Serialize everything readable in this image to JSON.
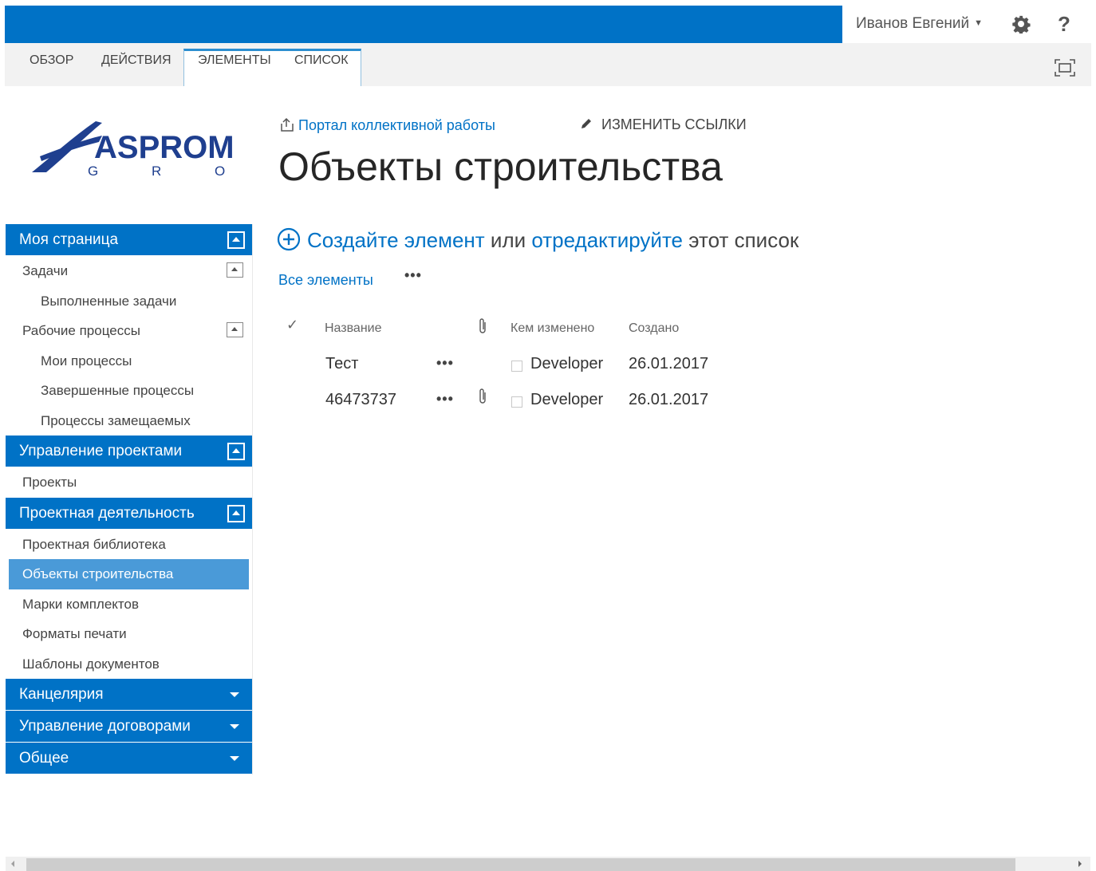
{
  "suitebar": {
    "user_name": "Иванов Евгений",
    "settings_icon": "gear-icon",
    "help_label": "?"
  },
  "ribbon": {
    "tabs": [
      {
        "label": "ОБЗОР"
      },
      {
        "label": "ДЕЙСТВИЯ"
      },
      {
        "label": "ЭЛЕМЕНТЫ"
      },
      {
        "label": "СПИСОК"
      }
    ],
    "focus_icon": "focus-on-content-icon"
  },
  "header": {
    "logo_text": "ASPROM",
    "logo_subtext": "G R O U P",
    "portal_link": "Портал коллективной работы",
    "edit_links": "ИЗМЕНИТЬ ССЫЛКИ",
    "title": "Объекты строительства"
  },
  "nav": {
    "groups": [
      {
        "title": "Моя страница",
        "items": [
          "Задачи",
          "Выполненные задачи",
          "Рабочие процессы",
          "Мои процессы",
          "Завершенные процессы",
          "Процессы замещаемых"
        ]
      },
      {
        "title": "Управление проектами",
        "items": [
          "Проекты"
        ]
      },
      {
        "title": "Проектная деятельность",
        "items": [
          "Проектная библиотека",
          "Объекты строительства",
          "Марки комплектов",
          "Форматы печати",
          "Шаблоны документов"
        ]
      },
      {
        "title": "Канцелярия"
      },
      {
        "title": "Управление договорами"
      },
      {
        "title": "Общее"
      }
    ],
    "selected": "Объекты строительства"
  },
  "main": {
    "create_link": "Создайте элемент",
    "or_text": "или",
    "edit_link": "отредактируйте",
    "list_text": "этот список",
    "view_all": "Все элементы",
    "more": "•••",
    "columns": {
      "check": "✓",
      "title": "Название",
      "modified_by": "Кем изменено",
      "created": "Создано"
    },
    "rows": [
      {
        "title": "Тест",
        "more": "•••",
        "has_attachment": false,
        "modified_by": "Developer",
        "created": "26.01.2017"
      },
      {
        "title": "46473737",
        "more": "•••",
        "has_attachment": true,
        "modified_by": "Developer",
        "created": "26.01.2017"
      }
    ]
  },
  "colors": {
    "brand_blue": "#0072c6",
    "selected_nav": "#4a9ad8"
  }
}
